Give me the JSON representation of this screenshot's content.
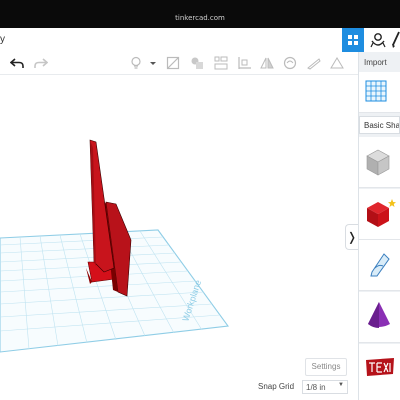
{
  "browser": {
    "url": "tinkercad.com"
  },
  "app": {
    "title_fragment": "y"
  },
  "toolbar": {
    "undo_icon": "undo-icon",
    "redo_icon": "redo-icon",
    "tools": [
      "light-bulb-icon",
      "group-icon",
      "ungroup-icon",
      "align-icon",
      "mirror-icon",
      "cruise-icon",
      "ruler-icon",
      "notes-icon"
    ]
  },
  "panel": {
    "import_label": "Import",
    "category_label": "Basic Shap",
    "shapes": [
      "box-hole",
      "box",
      "scribble",
      "cone",
      "text"
    ]
  },
  "workplane": {
    "label": "Workplane"
  },
  "settings_label": "Settings",
  "snap": {
    "label": "Snap Grid",
    "value": "1/8 in"
  },
  "colors": {
    "accent": "#1e8de0",
    "shape_red": "#c8141c",
    "grid": "#bfe3f1"
  }
}
